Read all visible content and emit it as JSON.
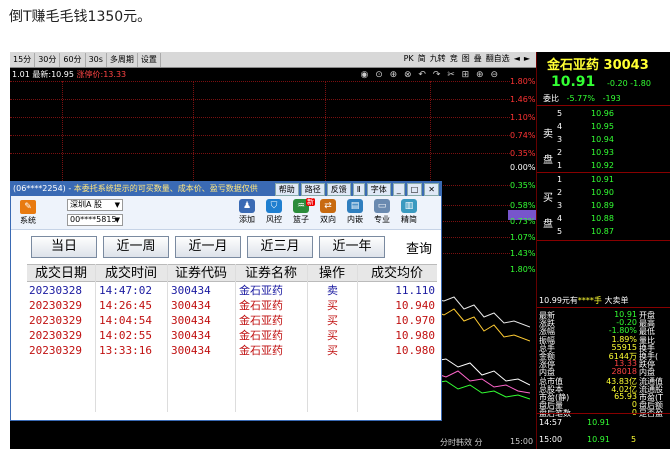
{
  "post": {
    "title": "倒T赚毛毛钱1350元。"
  },
  "chart_toolbar": {
    "items": [
      "15分",
      "30分",
      "60分",
      "30s",
      "多周期",
      "设置"
    ],
    "right_items": [
      "PK",
      "简",
      "九转",
      "竞",
      "图",
      "叠",
      "翻自选",
      "◄",
      "►"
    ]
  },
  "quote_line": {
    "prefix": "1.01  最新:",
    "last": "10.95",
    "sep": "  涨停价:",
    "limit": "13.33",
    "icons": "◉ ⊙ ⊕ ⊗ ↶ ↷ ✂ ⊞ ⊕ ⊖"
  },
  "pct_labels": [
    {
      "text": "1.80%",
      "cls": "r"
    },
    {
      "text": "1.46%",
      "cls": "r"
    },
    {
      "text": "1.10%",
      "cls": "r"
    },
    {
      "text": "0.74%",
      "cls": "r"
    },
    {
      "text": "0.35%",
      "cls": "r"
    },
    {
      "text": "0.00%",
      "cls": "w"
    },
    {
      "text": "0.35%",
      "cls": "g"
    },
    {
      "text": "0.58%",
      "cls": "g"
    },
    {
      "text": "0.73%",
      "cls": "g"
    },
    {
      "text": "1.07%",
      "cls": "g"
    },
    {
      "text": "1.43%",
      "cls": "g"
    },
    {
      "text": "1.80%",
      "cls": "g"
    }
  ],
  "time_labels": {
    "close": "15:00",
    "mode": "分时韩效  分"
  },
  "quote_panel": {
    "name": "金石亚药  30043",
    "price": "10.91",
    "change": "-0.20  -1.80",
    "weibi_label": "委比",
    "weibi_pct": "-5.77%",
    "weibi_diff": "-193",
    "sell_side": "卖盘",
    "buy_side": "买盘",
    "asks": [
      {
        "lv": "5",
        "price": "10.96"
      },
      {
        "lv": "4",
        "price": "10.95"
      },
      {
        "lv": "3",
        "price": "10.94"
      },
      {
        "lv": "2",
        "price": "10.93"
      },
      {
        "lv": "1",
        "price": "10.92"
      }
    ],
    "bids": [
      {
        "lv": "1",
        "price": "10.91"
      },
      {
        "lv": "2",
        "price": "10.90"
      },
      {
        "lv": "3",
        "price": "10.89"
      },
      {
        "lv": "4",
        "price": "10.88"
      },
      {
        "lv": "5",
        "price": "10.87"
      }
    ],
    "big_order": {
      "prefix": "10.99元有",
      "mid": "****手",
      "suffix": " 大卖单"
    },
    "stats": [
      {
        "k": "最新",
        "v": "10.91",
        "vc": "g",
        "k2": "开盘"
      },
      {
        "k": "涨跌",
        "v": "-0.20",
        "vc": "g",
        "k2": "最高"
      },
      {
        "k": "涨幅",
        "v": "-1.80%",
        "vc": "g",
        "k2": "最低"
      },
      {
        "k": "振幅",
        "v": "1.89%",
        "vc": "y",
        "k2": "量比"
      },
      {
        "k": "总手",
        "v": "55915",
        "vc": "y",
        "k2": "换手"
      },
      {
        "k": "金额",
        "v": "6144万",
        "vc": "y",
        "k2": "换手("
      },
      {
        "k": "涨停",
        "v": "13.33",
        "vc": "r",
        "k2": "跌停"
      },
      {
        "k": "内盘",
        "v": "28018",
        "vc": "r",
        "k2": "内盘"
      },
      {
        "k": "总市值",
        "v": "43.83亿",
        "vc": "y",
        "k2": "流通值"
      },
      {
        "k": "总股本",
        "v": "4.02亿",
        "vc": "y",
        "k2": "流通股"
      },
      {
        "k": "市盈(静)",
        "v": "65.93",
        "vc": "y",
        "k2": "市盈(T"
      },
      {
        "k": "盘后量",
        "v": "0",
        "vc": "y",
        "k2": "盘后额"
      },
      {
        "k": "盘后笔数",
        "v": "0",
        "vc": "y",
        "k2": "是否盈"
      }
    ],
    "ticks": [
      {
        "t": "14:57",
        "p": "10.91",
        "v": ""
      },
      {
        "t": "15:00",
        "p": "10.91",
        "v": "5"
      }
    ]
  },
  "dialog": {
    "title_prefix": "(06****2254) - ",
    "title_warning": "本委托系统提示的可买数量、成本价、盈亏数据仅供",
    "title_buttons": [
      "帮助",
      "路径",
      "反馈",
      "Ⅱ",
      "字体",
      "_",
      "□",
      "✕"
    ],
    "system_label": "系统",
    "market_select": "深圳A 股",
    "account_select": "00****5815",
    "tools": [
      {
        "label": "添加",
        "color": "#3a6ab4",
        "glyph": "♟"
      },
      {
        "label": "风控",
        "color": "#1f7fd0",
        "glyph": "⛉"
      },
      {
        "label": "篮子",
        "color": "#2a8c3a",
        "glyph": "♒",
        "badge": "新"
      },
      {
        "label": "双向",
        "color": "#c86a10",
        "glyph": "⇄"
      },
      {
        "label": "内嵌",
        "color": "#2f7fbf",
        "glyph": "▤"
      },
      {
        "label": "专业",
        "color": "#6a8ab0",
        "glyph": "▭"
      },
      {
        "label": "精简",
        "color": "#3a9ac0",
        "glyph": "▥"
      }
    ],
    "range_tabs": [
      "当日",
      "近一周",
      "近一月",
      "近三月",
      "近一年"
    ],
    "query_label": "查询",
    "columns": [
      "成交日期",
      "成交时间",
      "证券代码",
      "证券名称",
      "操作",
      "成交均价"
    ],
    "rows": [
      {
        "date": "20230328",
        "time": "14:47:02",
        "code": "300434",
        "name": "金石亚药",
        "op": "卖",
        "price": "11.110",
        "side": "sell"
      },
      {
        "date": "20230329",
        "time": "14:26:45",
        "code": "300434",
        "name": "金石亚药",
        "op": "买",
        "price": "10.940",
        "side": "buy"
      },
      {
        "date": "20230329",
        "time": "14:04:54",
        "code": "300434",
        "name": "金石亚药",
        "op": "买",
        "price": "10.970",
        "side": "buy"
      },
      {
        "date": "20230329",
        "time": "14:02:55",
        "code": "300434",
        "name": "金石亚药",
        "op": "买",
        "price": "10.980",
        "side": "buy"
      },
      {
        "date": "20230329",
        "time": "13:33:16",
        "code": "300434",
        "name": "金石亚药",
        "op": "买",
        "price": "10.980",
        "side": "buy"
      }
    ]
  }
}
